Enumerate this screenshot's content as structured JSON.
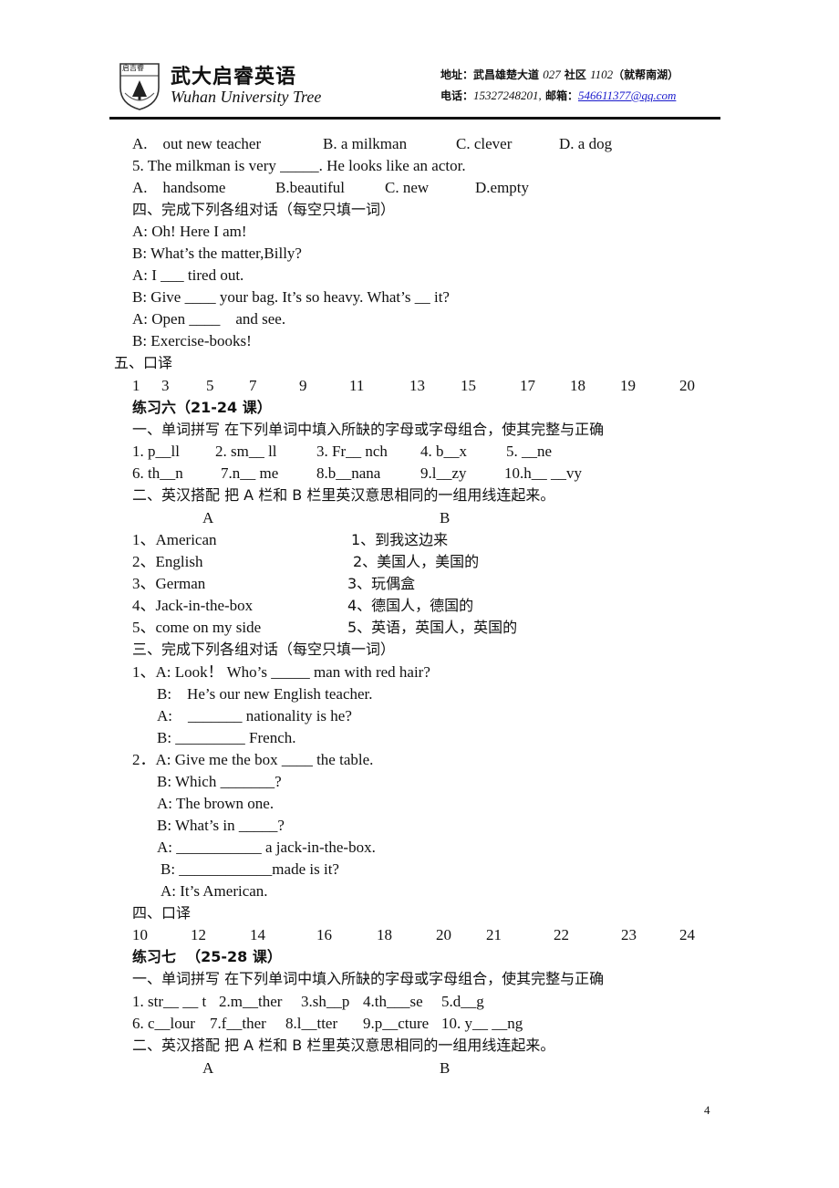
{
  "header": {
    "logo_text": "启吉睿",
    "brand_cn": "武大启睿英语",
    "brand_en": "Wuhan University Tree",
    "address_label": "地址：武昌雄楚大道",
    "address_num1": "027",
    "address_mid": "社区",
    "address_num2": "1102",
    "address_tail": "（就帮南湖）",
    "phone_label": "电话：",
    "phone": "15327248201,",
    "email_label": "邮箱：",
    "email": "546611377@qq.com"
  },
  "lines": {
    "l01": {
      "a": "A.    out new teacher",
      "b": "B. a milkman",
      "c": "C. clever",
      "d": "D. a dog"
    },
    "l02": "5. The milkman is very _____. He looks like an actor.",
    "l03": {
      "a": "A.    handsome",
      "b": "B.beautiful",
      "c": "C. new",
      "d": "D.empty"
    },
    "l04": "四、完成下列各组对话（每空只填一词）",
    "l05": "A: Oh! Here I am!",
    "l06": "B: What’s the matter,Billy?",
    "l07": "A: I ___ tired out.",
    "l08": "B: Give ____ your bag. It’s so heavy. What’s __ it?",
    "l09": "A: Open ____    and see.",
    "l10": "B: Exercise-books!",
    "l11": "五、口译",
    "l12": [
      "1",
      "3",
      "5",
      "7",
      "9",
      "11",
      "13",
      "15",
      "17",
      "18",
      "19",
      "20"
    ],
    "l13": "练习六（21-24 课）",
    "l14": "一、单词拼写 在下列单词中填入所缺的字母或字母组合，使其完整与正确",
    "l15": [
      "1. p__ll",
      "2. sm__ ll",
      "3. Fr__ nch",
      "4. b__x",
      "5. __ne"
    ],
    "l16": [
      "6. th__n",
      "7.n__ me",
      "8.b__nana",
      "9.l__zy",
      "10.h__ __vy"
    ],
    "l17": "二、英汉搭配 把 A 栏和 B 栏里英汉意思相同的一组用线连起来。",
    "l18": {
      "a": "A",
      "b": "B"
    },
    "match1": {
      "a": [
        "1、American",
        "2、English",
        "3、German",
        "4、Jack-in-the-box",
        "5、come on my side"
      ],
      "b": [
        "1、到我这边来",
        "2、美国人，美国的",
        "3、玩偶盒",
        "4、德国人，德国的",
        "5、英语，英国人，英国的"
      ]
    },
    "l24": "三、完成下列各组对话（每空只填一词）",
    "l25": "1、A: Look！ Who’s _____ man with red hair?",
    "l26": "B:    He’s our new English teacher.",
    "l27": "A:    _______ nationality is he?",
    "l28": "B: _________ French.",
    "l29": "2．A: Give me the box ____ the table.",
    "l30": "B: Which _______?",
    "l31": "A: The brown one.",
    "l32": "B: What’s in _____?",
    "l33": "A: ___________ a jack-in-the-box.",
    "l34": "B: ____________made is it?",
    "l35": "A: It’s American.",
    "l36": "四、口译",
    "l37": [
      "10",
      "12",
      "14",
      "16",
      "18",
      "20",
      "21",
      "22",
      "23",
      "24"
    ],
    "l38": "练习七  （25-28 课）",
    "l39": "一、单词拼写 在下列单词中填入所缺的字母或字母组合，使其完整与正确",
    "l40": [
      "1. str__ __ t",
      "2.m__ther",
      "3.sh__p",
      "4.th___se",
      "5.d__g"
    ],
    "l41": [
      "6. c__lour",
      "7.f__ther",
      "8.l__tter",
      "9.p__cture",
      "10. y__ __ng"
    ],
    "l42": "二、英汉搭配 把 A 栏和 B 栏里英汉意思相同的一组用线连起来。",
    "l43": {
      "a": "A",
      "b": "B"
    }
  },
  "footer": {
    "page_number": "4"
  }
}
